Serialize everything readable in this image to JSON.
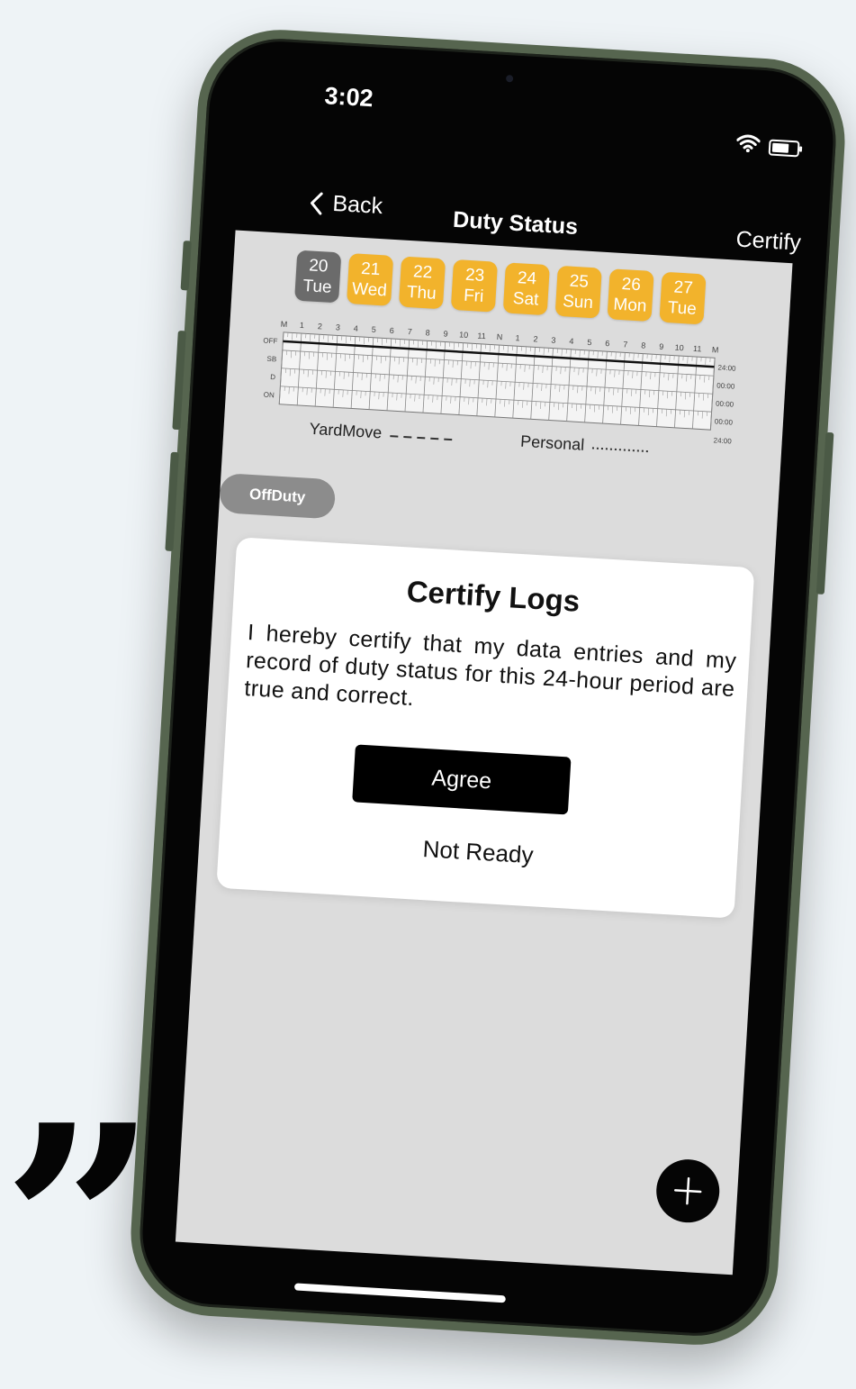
{
  "status_bar": {
    "time": "3:02",
    "wifi_icon": "wifi-icon",
    "battery_icon": "battery-icon"
  },
  "nav": {
    "back_label": "Back",
    "title": "Duty Status",
    "certify_label": "Certify"
  },
  "dates": [
    {
      "day": "20",
      "weekday": "Tue",
      "selected": true
    },
    {
      "day": "21",
      "weekday": "Wed",
      "selected": false
    },
    {
      "day": "22",
      "weekday": "Thu",
      "selected": false
    },
    {
      "day": "23",
      "weekday": "Fri",
      "selected": false
    },
    {
      "day": "24",
      "weekday": "Sat",
      "selected": false
    },
    {
      "day": "25",
      "weekday": "Sun",
      "selected": false
    },
    {
      "day": "26",
      "weekday": "Mon",
      "selected": false
    },
    {
      "day": "27",
      "weekday": "Tue",
      "selected": false
    }
  ],
  "log_graph": {
    "hour_labels": [
      "M",
      "1",
      "2",
      "3",
      "4",
      "5",
      "6",
      "7",
      "8",
      "9",
      "10",
      "11",
      "N",
      "1",
      "2",
      "3",
      "4",
      "5",
      "6",
      "7",
      "8",
      "9",
      "10",
      "11",
      "M"
    ],
    "row_labels": [
      "OFF",
      "SB",
      "D",
      "ON"
    ],
    "row_totals": [
      "24:00",
      "00:00",
      "00:00",
      "00:00"
    ],
    "grand_total": "24:00",
    "status_line_row": 0
  },
  "legend": {
    "yardmove": "YardMove",
    "personal": "Personal"
  },
  "status_pill": "OffDuty",
  "dialog": {
    "title": "Certify Logs",
    "message": "I hereby certify that my data entries and my record of duty status for this 24-hour period are true and correct.",
    "agree_label": "Agree",
    "not_ready_label": "Not Ready"
  },
  "fab_icon": "plus-icon",
  "colors": {
    "date_chip": "#f2b32c",
    "date_chip_selected": "#6b6b6b",
    "screen_bg": "#dcdcdc",
    "phone_frame": "#56654f"
  }
}
